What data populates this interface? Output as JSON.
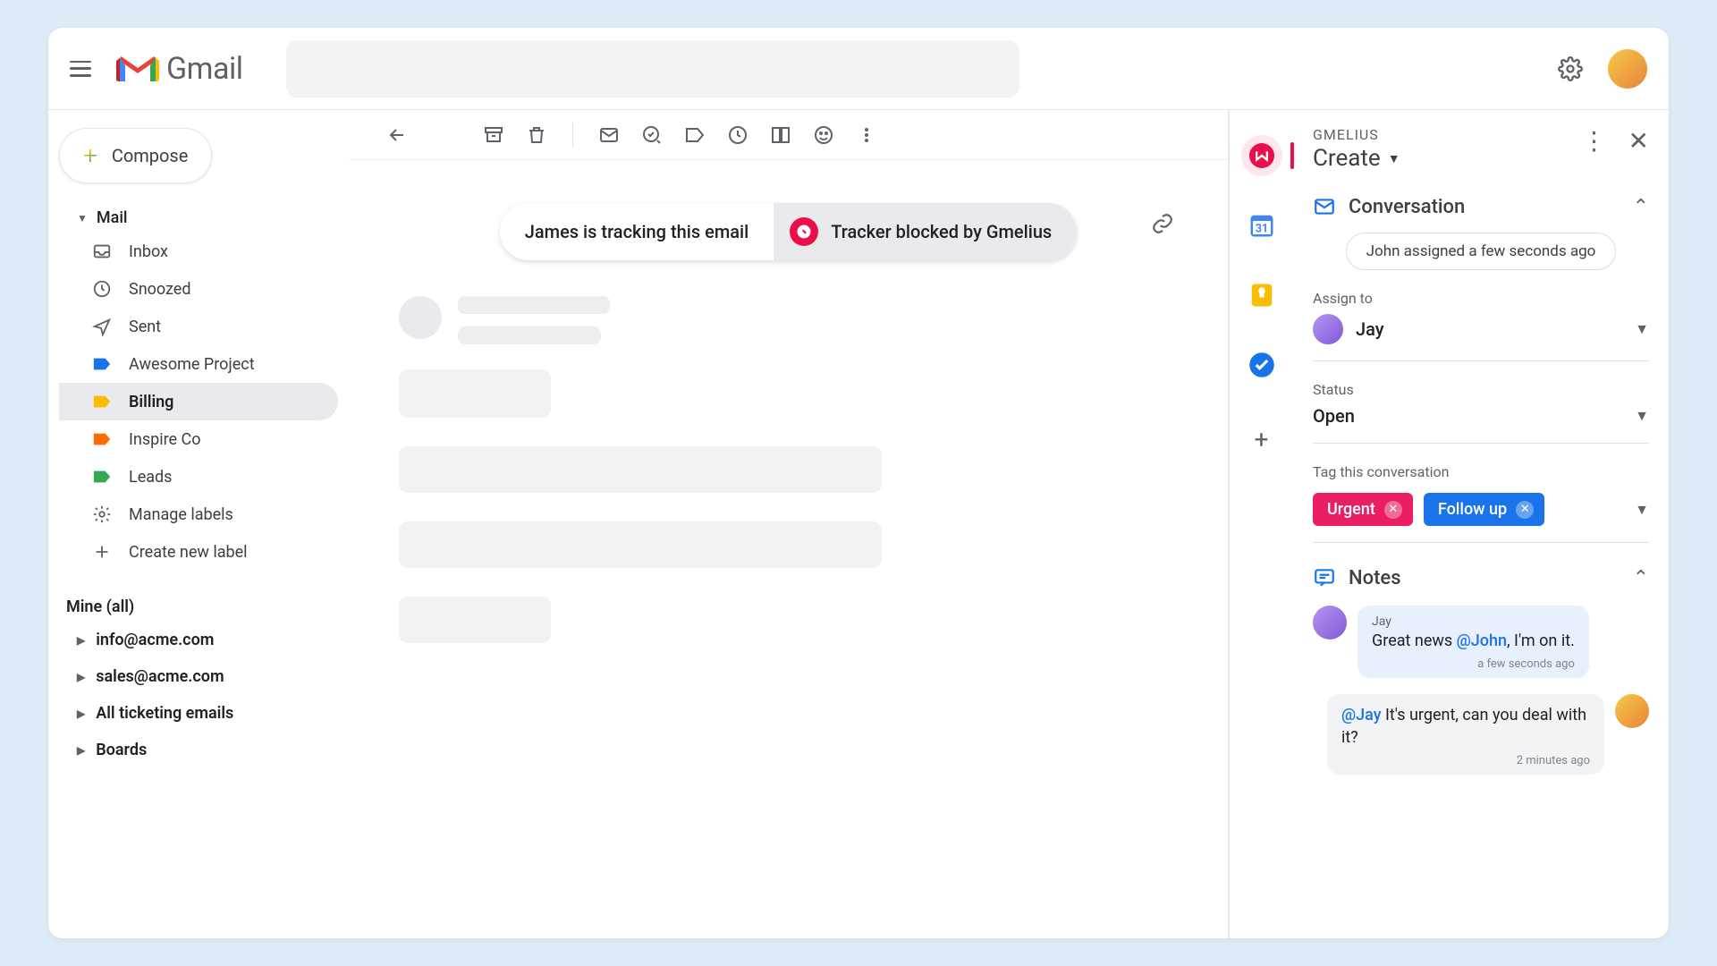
{
  "header": {
    "product": "Gmail"
  },
  "compose": {
    "label": "Compose"
  },
  "sidebar": {
    "mail_label": "Mail",
    "items": [
      {
        "label": "Inbox"
      },
      {
        "label": "Snoozed"
      },
      {
        "label": "Sent"
      },
      {
        "label": "Awesome Project"
      },
      {
        "label": "Billing"
      },
      {
        "label": "Inspire Co"
      },
      {
        "label": "Leads"
      },
      {
        "label": "Manage labels"
      },
      {
        "label": "Create new label"
      }
    ],
    "mine_label": "Mine (all)",
    "groups": [
      {
        "label": "info@acme.com"
      },
      {
        "label": "sales@acme.com"
      },
      {
        "label": "All ticketing emails"
      },
      {
        "label": "Boards"
      }
    ]
  },
  "tracker": {
    "left": "James is tracking this email",
    "right": "Tracker blocked by Gmelius"
  },
  "panel": {
    "brand": "GMELIUS",
    "create": "Create",
    "conversation": {
      "title": "Conversation",
      "assignment_pill": "John assigned a few seconds ago",
      "assign_label": "Assign to",
      "assignee": "Jay",
      "status_label": "Status",
      "status_value": "Open",
      "tag_label": "Tag this conversation",
      "tags": [
        {
          "label": "Urgent",
          "kind": "urgent"
        },
        {
          "label": "Follow up",
          "kind": "followup"
        }
      ]
    },
    "notes": {
      "title": "Notes",
      "items": [
        {
          "side": "left",
          "author": "Jay",
          "pre": "Great news ",
          "mention": "@John",
          "post": ", I'm on it.",
          "time": "a few seconds ago"
        },
        {
          "side": "right",
          "author": "",
          "pre": "",
          "mention": "@Jay",
          "post": " It's urgent, can you deal with it?",
          "time": "2 minutes ago"
        }
      ]
    }
  }
}
